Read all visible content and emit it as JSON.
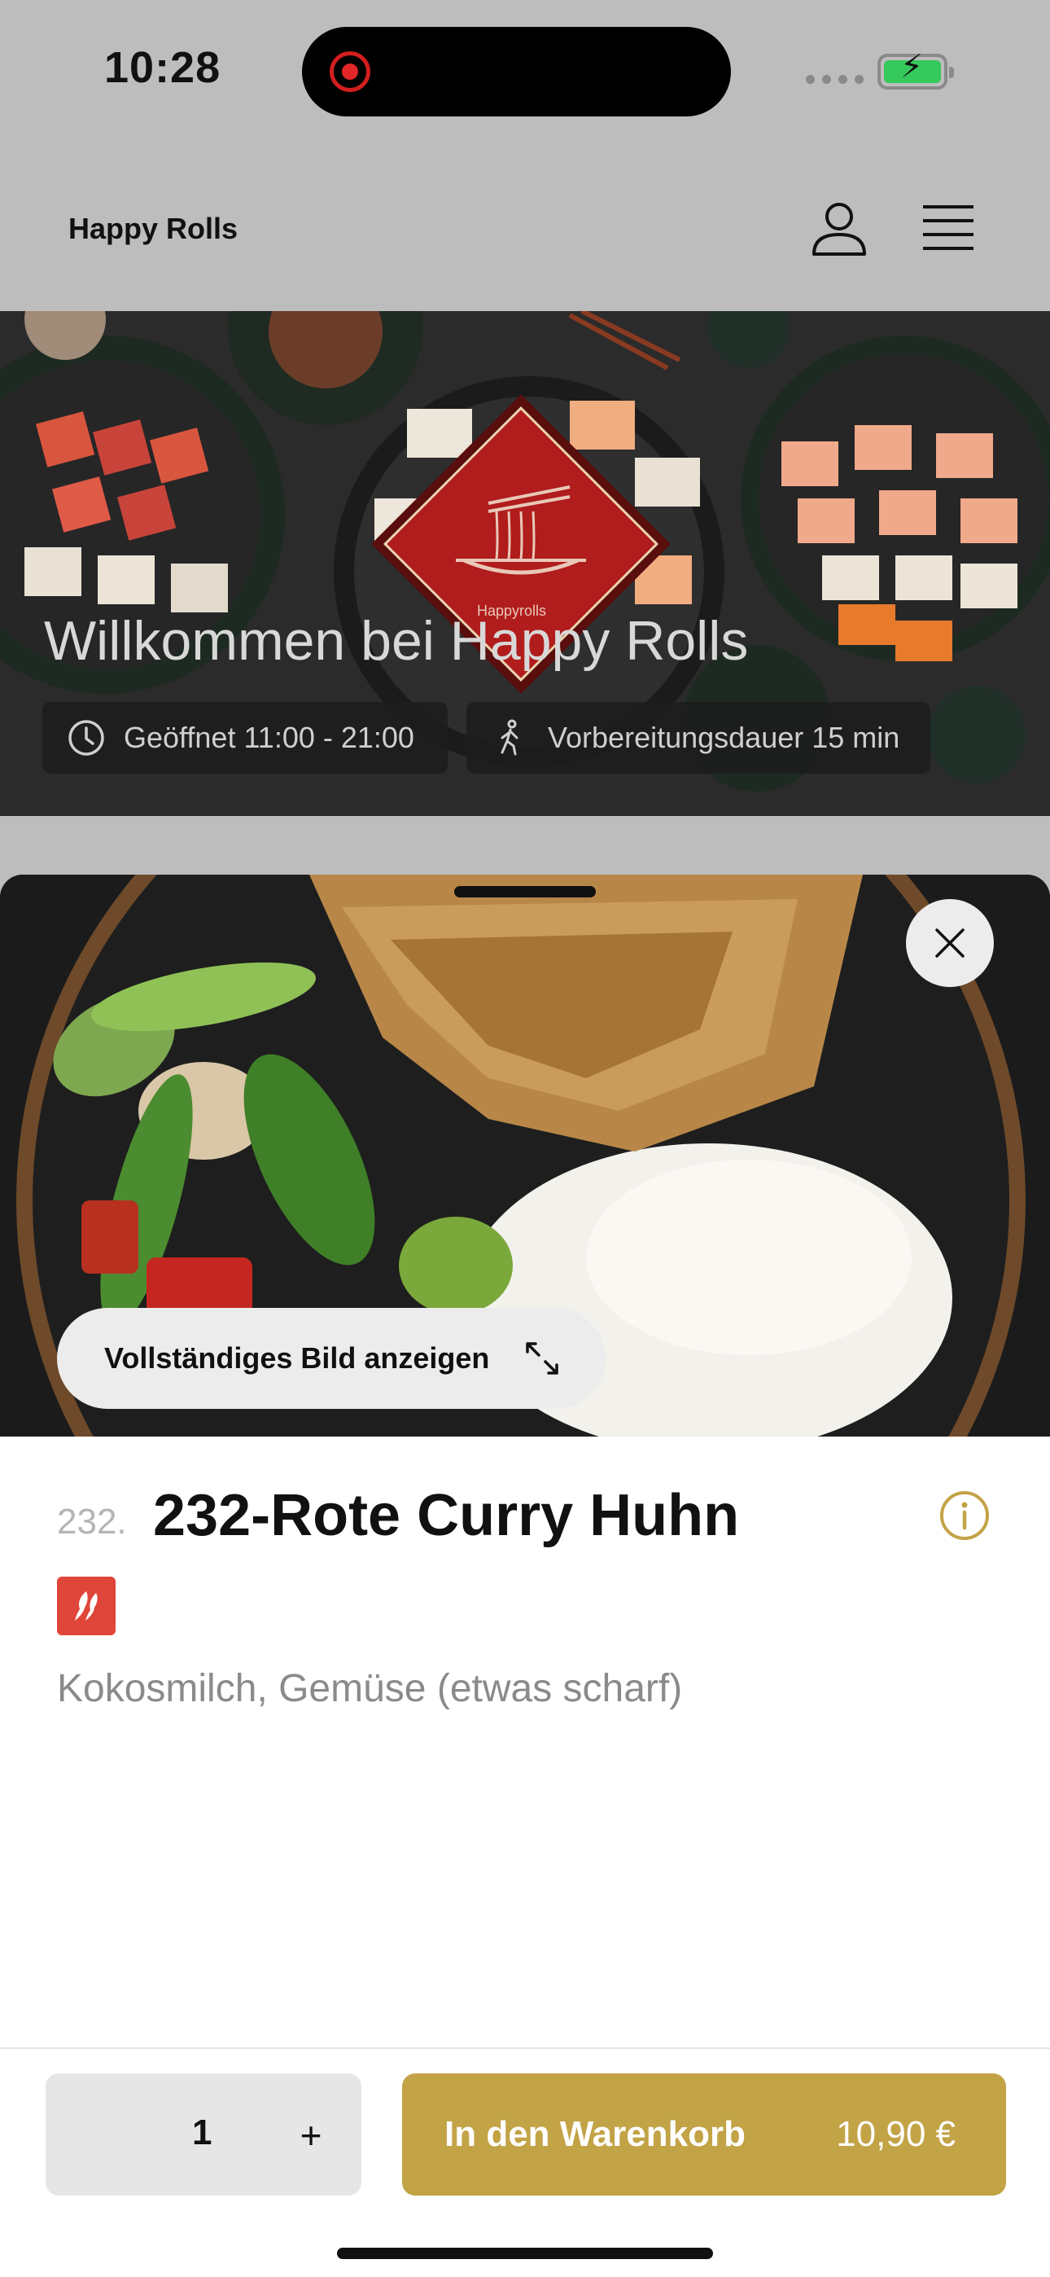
{
  "status_bar": {
    "time": "10:28"
  },
  "header": {
    "brand": "Happy Rolls"
  },
  "hero": {
    "title": "Willkommen bei Happy Rolls",
    "logo_text": "Happyrolls",
    "opening_hours": "Geöffnet 11:00 - 21:00",
    "prep_time": "Vorbereitungsdauer 15 min"
  },
  "product": {
    "full_image_label": "Vollständiges Bild anzeigen",
    "number": "232.",
    "name": "232-Rote Curry Huhn",
    "description": "Kokosmilch, Gemüse (etwas scharf)"
  },
  "cart": {
    "quantity": "1",
    "plus_label": "+",
    "add_label": "In den Warenkorb",
    "price": "10,90 €"
  },
  "colors": {
    "accent_gold": "#c2a346",
    "chili_red": "#e0453a",
    "battery_green": "#35c85a"
  },
  "icons": [
    "user-icon",
    "menu-icon",
    "clock-icon",
    "walking-icon",
    "close-icon",
    "expand-icon",
    "info-icon",
    "chili-icon"
  ]
}
